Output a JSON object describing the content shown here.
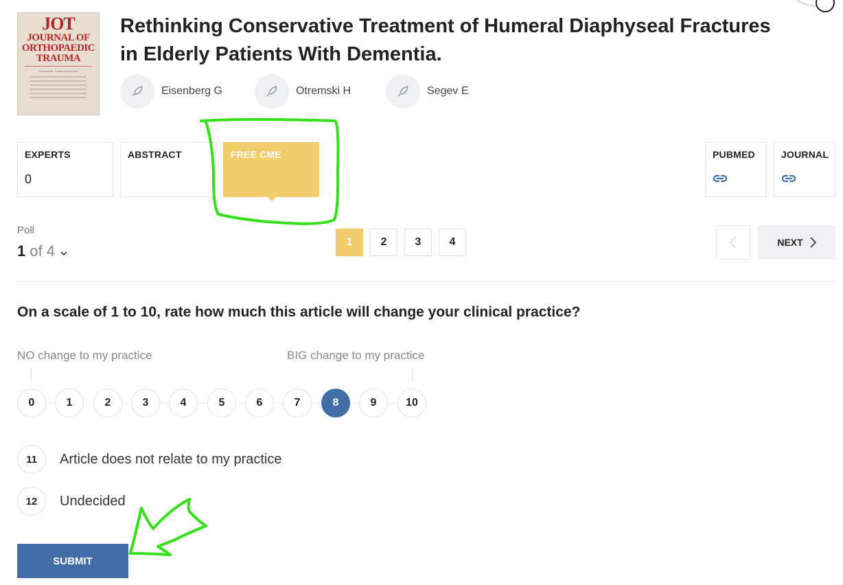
{
  "cover": {
    "masthead": "JOT",
    "journal_name_line1": "JOURNAL OF",
    "journal_name_line2": "ORTHOPAEDIC",
    "journal_name_line3": "TRAUMA",
    "subtitle": "Orthopaedic Trauma Association"
  },
  "article": {
    "title": "Rethinking Conservative Treatment of Humeral Diaphyseal Fractures in Elderly Patients With Dementia."
  },
  "authors": [
    {
      "name": "Eisenberg G",
      "icon": "feather-icon"
    },
    {
      "name": "Otremski H",
      "icon": "feather-icon"
    },
    {
      "name": "Segev E",
      "icon": "feather-icon"
    }
  ],
  "tabs": {
    "experts": {
      "label": "EXPERTS",
      "value": "0"
    },
    "abstract": {
      "label": "ABSTRACT"
    },
    "free_cme": {
      "label": "FREE CME"
    },
    "pubmed": {
      "label": "PUBMED",
      "icon": "link-icon"
    },
    "journal": {
      "label": "JOURNAL",
      "icon": "link-icon"
    }
  },
  "poll": {
    "label": "Poll",
    "current": "1",
    "of_text": " of 4",
    "pages": [
      "1",
      "2",
      "3",
      "4"
    ],
    "active_page": "1",
    "next_label": "NEXT"
  },
  "question": {
    "text": "On a scale of 1 to 10, rate how much this article will change your clinical practice?",
    "low_label": "NO change to my practice",
    "high_label": "BIG change to my practice",
    "ratings": [
      "0",
      "1",
      "2",
      "3",
      "4",
      "5",
      "6",
      "7",
      "8",
      "9",
      "10"
    ],
    "selected": "8",
    "options": [
      {
        "num": "11",
        "label": "Article does not relate to my practice"
      },
      {
        "num": "12",
        "label": "Undecided"
      }
    ],
    "submit_label": "SUBMIT"
  },
  "colors": {
    "accent_yellow": "#f2cb6b",
    "primary_blue": "#436ea5",
    "annotation_green": "#33e01a"
  }
}
